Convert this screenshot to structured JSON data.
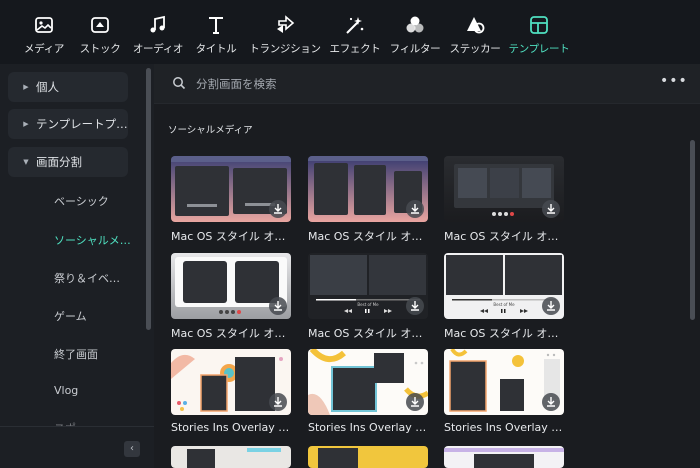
{
  "toolbar": {
    "items": [
      {
        "label": "メディア",
        "icon": "media-icon"
      },
      {
        "label": "ストック",
        "icon": "stock-icon"
      },
      {
        "label": "オーディオ",
        "icon": "music-note-icon"
      },
      {
        "label": "タイトル",
        "icon": "title-text-icon"
      },
      {
        "label": "トランジション",
        "icon": "transition-icon"
      },
      {
        "label": "エフェクト",
        "icon": "effects-icon"
      },
      {
        "label": "フィルター",
        "icon": "filter-icon"
      },
      {
        "label": "ステッカー",
        "icon": "sticker-icon"
      },
      {
        "label": "テンプレート",
        "icon": "template-icon",
        "active": true
      }
    ]
  },
  "sidebar": {
    "categories": [
      {
        "label": "個人",
        "expanded": false
      },
      {
        "label": "テンプレートプ…",
        "expanded": false
      },
      {
        "label": "画面分割",
        "expanded": true
      }
    ],
    "subitems": [
      "ベーシック",
      "ソーシャルメ…",
      "祭り＆イベ…",
      "ゲーム",
      "終了画面",
      "Vlog",
      "スポー…"
    ],
    "active_subitem": "ソーシャルメ…",
    "collapse_icon": "chevron-left-icon"
  },
  "search": {
    "placeholder": "分割画面を検索"
  },
  "section": {
    "title": "ソーシャルメディア"
  },
  "cards": [
    {
      "name": "Mac OS スタイル オー…",
      "style": "macos-pink"
    },
    {
      "name": "Mac OS スタイル オー…",
      "style": "macos-pink3"
    },
    {
      "name": "Mac OS スタイル オー…",
      "style": "macos-dark"
    },
    {
      "name": "Mac OS スタイル オー…",
      "style": "macos-silver"
    },
    {
      "name": "Mac OS スタイル オー…",
      "style": "player-dark"
    },
    {
      "name": "Mac OS スタイル オー…",
      "style": "player-silver"
    },
    {
      "name": "Stories Ins Overlay …",
      "style": "stories-1"
    },
    {
      "name": "Stories Ins Overlay …",
      "style": "stories-2"
    },
    {
      "name": "Stories Ins Overlay …",
      "style": "stories-3"
    }
  ],
  "player_caption": "Best of Me",
  "colors": {
    "accent": "#4fe0c0",
    "background": "#1a1c20",
    "sidebar": "#1c1f24"
  }
}
